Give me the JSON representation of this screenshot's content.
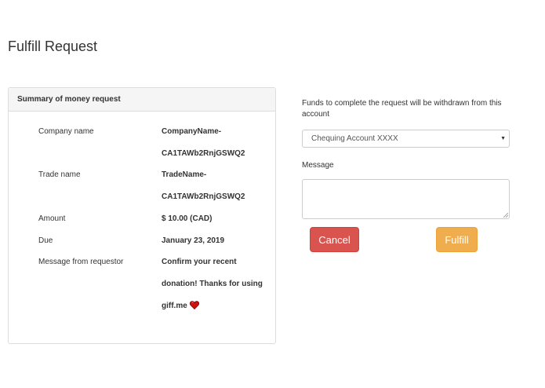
{
  "page": {
    "title": "Fulfill Request"
  },
  "summary": {
    "heading": "Summary of money request",
    "rows": [
      {
        "label": "Company name",
        "value_lines": [
          "CompanyName-",
          "CA1TAWb2RnjGSWQ2"
        ]
      },
      {
        "label": "Trade name",
        "value_lines": [
          "TradeName-",
          "CA1TAWb2RnjGSWQ2"
        ]
      },
      {
        "label": "Amount",
        "value_lines": [
          "$ 10.00 (CAD)"
        ]
      },
      {
        "label": "Due",
        "value_lines": [
          "January 23, 2019"
        ]
      },
      {
        "label": "Message from requestor",
        "value_lines": [
          "Confirm your recent",
          "donation! Thanks for using",
          "giff.me"
        ]
      }
    ],
    "message_icon": "heart-icon"
  },
  "form": {
    "account_label": "Funds to complete the request will be withdrawn from this account",
    "account_select": {
      "selected": "Chequing Account XXXX",
      "caret": "▼"
    },
    "message_label": "Message",
    "message_value": ""
  },
  "buttons": {
    "cancel_label": "Cancel",
    "fulfill_label": "Fulfill"
  },
  "colors": {
    "cancel": "#d9534f",
    "fulfill": "#f0ad4e",
    "heart": "#cc1111"
  }
}
